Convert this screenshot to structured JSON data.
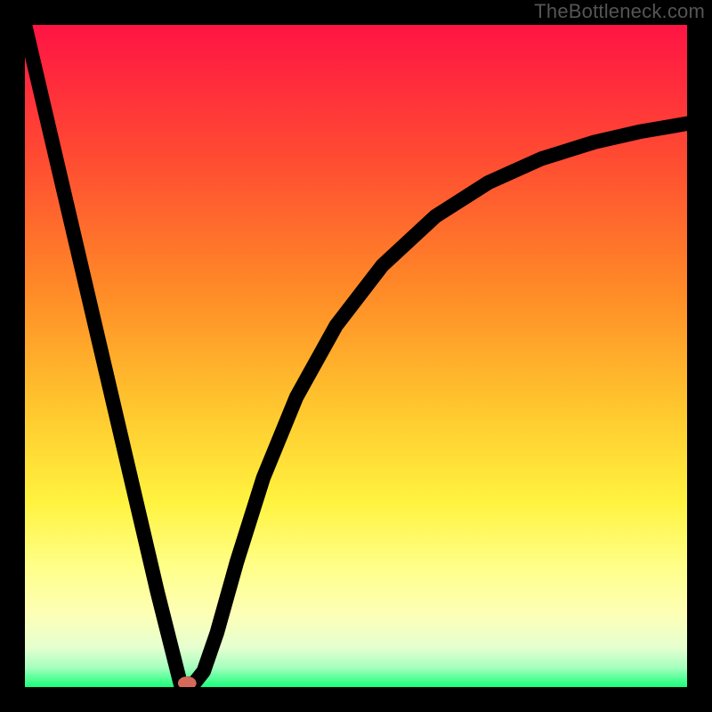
{
  "watermark": "TheBottleneck.com",
  "chart_data": {
    "type": "line",
    "title": "",
    "xlabel": "",
    "ylabel": "",
    "xlim": [
      0,
      100
    ],
    "ylim": [
      0,
      100
    ],
    "gradient_stops": [
      {
        "offset": 0,
        "color": "#ff1444"
      },
      {
        "offset": 20,
        "color": "#ff4b32"
      },
      {
        "offset": 40,
        "color": "#ff8a27"
      },
      {
        "offset": 58,
        "color": "#ffc72e"
      },
      {
        "offset": 72,
        "color": "#fff33f"
      },
      {
        "offset": 82,
        "color": "#ffff8a"
      },
      {
        "offset": 89,
        "color": "#fdffb6"
      },
      {
        "offset": 94,
        "color": "#e6ffd0"
      },
      {
        "offset": 97,
        "color": "#a7ffbf"
      },
      {
        "offset": 100,
        "color": "#19ff7a"
      }
    ],
    "series": [
      {
        "name": "curve",
        "x": [
          0,
          5,
          10,
          15,
          20,
          23.5,
          25.5,
          27,
          29,
          32,
          36,
          41,
          47,
          54,
          62,
          70,
          78,
          86,
          93,
          100
        ],
        "y": [
          100,
          78.6,
          57.2,
          35.8,
          14.4,
          0.5,
          0.5,
          2.4,
          8.2,
          18.9,
          31.6,
          43.8,
          54.6,
          63.7,
          71.1,
          76.2,
          79.8,
          82.3,
          83.9,
          85.1
        ]
      }
    ],
    "marker": {
      "x": 24.5,
      "y": 0.6,
      "rx": 1.4,
      "ry": 1.0,
      "color": "#d66a5a"
    }
  }
}
